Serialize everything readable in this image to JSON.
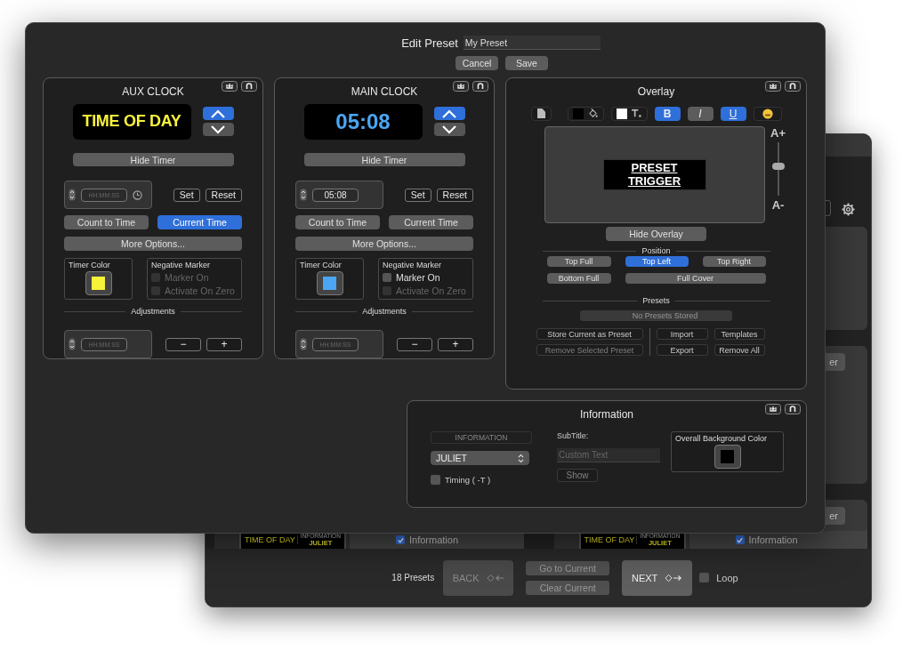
{
  "header": {
    "title": "Edit Preset",
    "name": "My Preset",
    "buttons": [
      "Cancel",
      "Save"
    ]
  },
  "clocks": [
    {
      "title": "AUX CLOCK",
      "display": "TIME OF DAY",
      "hide_button": "Hide Timer",
      "time_field": {
        "placeholder": "HH:MM:SS"
      },
      "clock_icon": true,
      "set_button": "Set",
      "reset_button": "Reset",
      "modes": [
        {
          "label": "Count to Time",
          "selected": false
        },
        {
          "label": "Current Time",
          "selected": true
        }
      ],
      "more_button": "More Options...",
      "timer_color": {
        "label": "Timer Color",
        "color": "#f7f23a"
      },
      "negative_marker": {
        "title": "Negative Marker",
        "options": [
          {
            "label": "Marker On",
            "checked": false,
            "disabled": true
          },
          {
            "label": "Activate On Zero",
            "checked": false,
            "disabled": true
          }
        ]
      },
      "adjustments": {
        "title": "Adjustments",
        "placeholder": "HH:MM:SS",
        "minus": "−",
        "plus": "+"
      }
    },
    {
      "title": "MAIN CLOCK",
      "display": "05:08",
      "hide_button": "Hide Timer",
      "time_field": {
        "value": "05:08"
      },
      "clock_icon": false,
      "set_button": "Set",
      "reset_button": "Reset",
      "modes": [
        {
          "label": "Count to Time",
          "selected": false
        },
        {
          "label": "Current Time",
          "selected": false
        }
      ],
      "more_button": "More Options...",
      "timer_color": {
        "label": "Timer Color",
        "color": "#4aa6f2"
      },
      "negative_marker": {
        "title": "Negative Marker",
        "options": [
          {
            "label": "Marker On",
            "checked": false,
            "disabled": false
          },
          {
            "label": "Activate On Zero",
            "checked": false,
            "disabled": true
          }
        ]
      },
      "adjustments": {
        "title": "Adjustments",
        "placeholder": "HH:MM:SS",
        "minus": "−",
        "plus": "+"
      }
    }
  ],
  "overlay": {
    "title": "Overlay",
    "styles": [
      {
        "kind": "bold",
        "label": "B",
        "selected": true
      },
      {
        "kind": "italic",
        "label": "I",
        "selected": false
      },
      {
        "kind": "underline",
        "label": "U",
        "selected": true
      }
    ],
    "preview_lines": [
      "PRESET",
      "TRIGGER"
    ],
    "size_up": "A+",
    "size_down": "A-",
    "size": {
      "level": 0.55
    },
    "hide_button": "Hide Overlay",
    "position": {
      "title": "Position",
      "options": [
        {
          "label": "Top Full",
          "selected": false
        },
        {
          "label": "Top Left",
          "selected": true
        },
        {
          "label": "Top Right",
          "selected": false
        },
        {
          "label": "Bottom Full",
          "selected": false
        },
        {
          "label": "Full Cover",
          "selected": false
        }
      ]
    },
    "presets": {
      "title": "Presets",
      "dropdown": "No Presets Stored",
      "buttons": [
        {
          "label": "Store Current as Preset",
          "disabled": false
        },
        {
          "label": "Import",
          "disabled": false
        },
        {
          "label": "Templates",
          "disabled": false
        },
        {
          "label": "Remove Selected Preset",
          "disabled": true
        },
        {
          "label": "Export",
          "disabled": false
        },
        {
          "label": "Remove All",
          "disabled": false
        }
      ]
    }
  },
  "information": {
    "title": "Information",
    "category": "INFORMATION",
    "select": "JULIET",
    "timing": {
      "label": "Timing ( -T )",
      "checked": false
    },
    "subtitle_label": "SubTitle:",
    "subtitle_placeholder": "Custom Text",
    "show_button": {
      "label": "Show",
      "disabled": true
    },
    "background": {
      "label": "Overall Background Color",
      "color": "#000000"
    }
  },
  "background_window": {
    "side_panels": [
      {
        "kind": "plain"
      },
      {
        "kind": "button",
        "button": "er"
      },
      {
        "kind": "button",
        "button": "er"
      }
    ],
    "presets": [
      {
        "clock": "TIME OF DAY",
        "info_title": "INFORMATION",
        "info_value": "JULIET",
        "label": "Information",
        "checked": true
      },
      {
        "clock": "TIME OF DAY",
        "info_title": "INFORMATION",
        "info_value": "JULIET",
        "label": "Information",
        "checked": true
      }
    ],
    "footer": {
      "count": "18 Presets",
      "back": {
        "label": "BACK",
        "disabled": true
      },
      "go_to_current": "Go to Current",
      "clear_current": "Clear Current",
      "next": {
        "label": "NEXT",
        "disabled": false
      },
      "loop": {
        "label": "Loop",
        "checked": false
      }
    }
  }
}
